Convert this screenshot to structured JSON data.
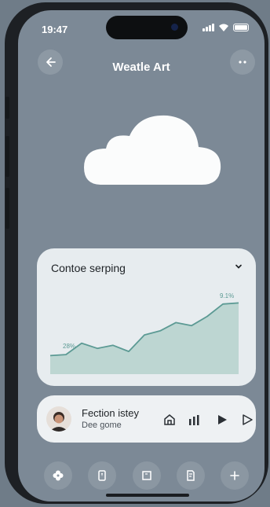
{
  "status": {
    "time": "19:47",
    "battery_level": 1.0
  },
  "header": {
    "title": "Weatle Art",
    "back_icon": "arrow-left-icon",
    "more_icon": "more-dots-icon"
  },
  "hero": {
    "icon": "cloud-icon"
  },
  "card": {
    "title": "Contoe serping",
    "chevron_icon": "chevron-down-icon",
    "chart_data": {
      "type": "area",
      "x": [
        0,
        1,
        2,
        3,
        4,
        5,
        6,
        7,
        8,
        9,
        10,
        11,
        12
      ],
      "values": [
        18,
        19,
        30,
        25,
        28,
        22,
        38,
        42,
        50,
        47,
        56,
        68,
        69
      ],
      "ylim": [
        0,
        80
      ],
      "labels": [
        {
          "text": "28%",
          "index": 1
        },
        {
          "text": "9.1%",
          "index": 11
        }
      ],
      "color": "#5c9a94"
    }
  },
  "player": {
    "title": "Fection istey",
    "subtitle": "Dee gome",
    "avatar_icon": "avatar-icon",
    "controls": [
      "home-icon",
      "bars-icon",
      "play-icon",
      "play-outline-icon"
    ]
  },
  "dock": {
    "items": [
      "flower-icon",
      "phone-icon",
      "square-icon",
      "document-icon",
      "plus-icon"
    ]
  },
  "colors": {
    "background": "#7c8996",
    "card": "#e7ecef",
    "accent": "#5c9a94"
  }
}
